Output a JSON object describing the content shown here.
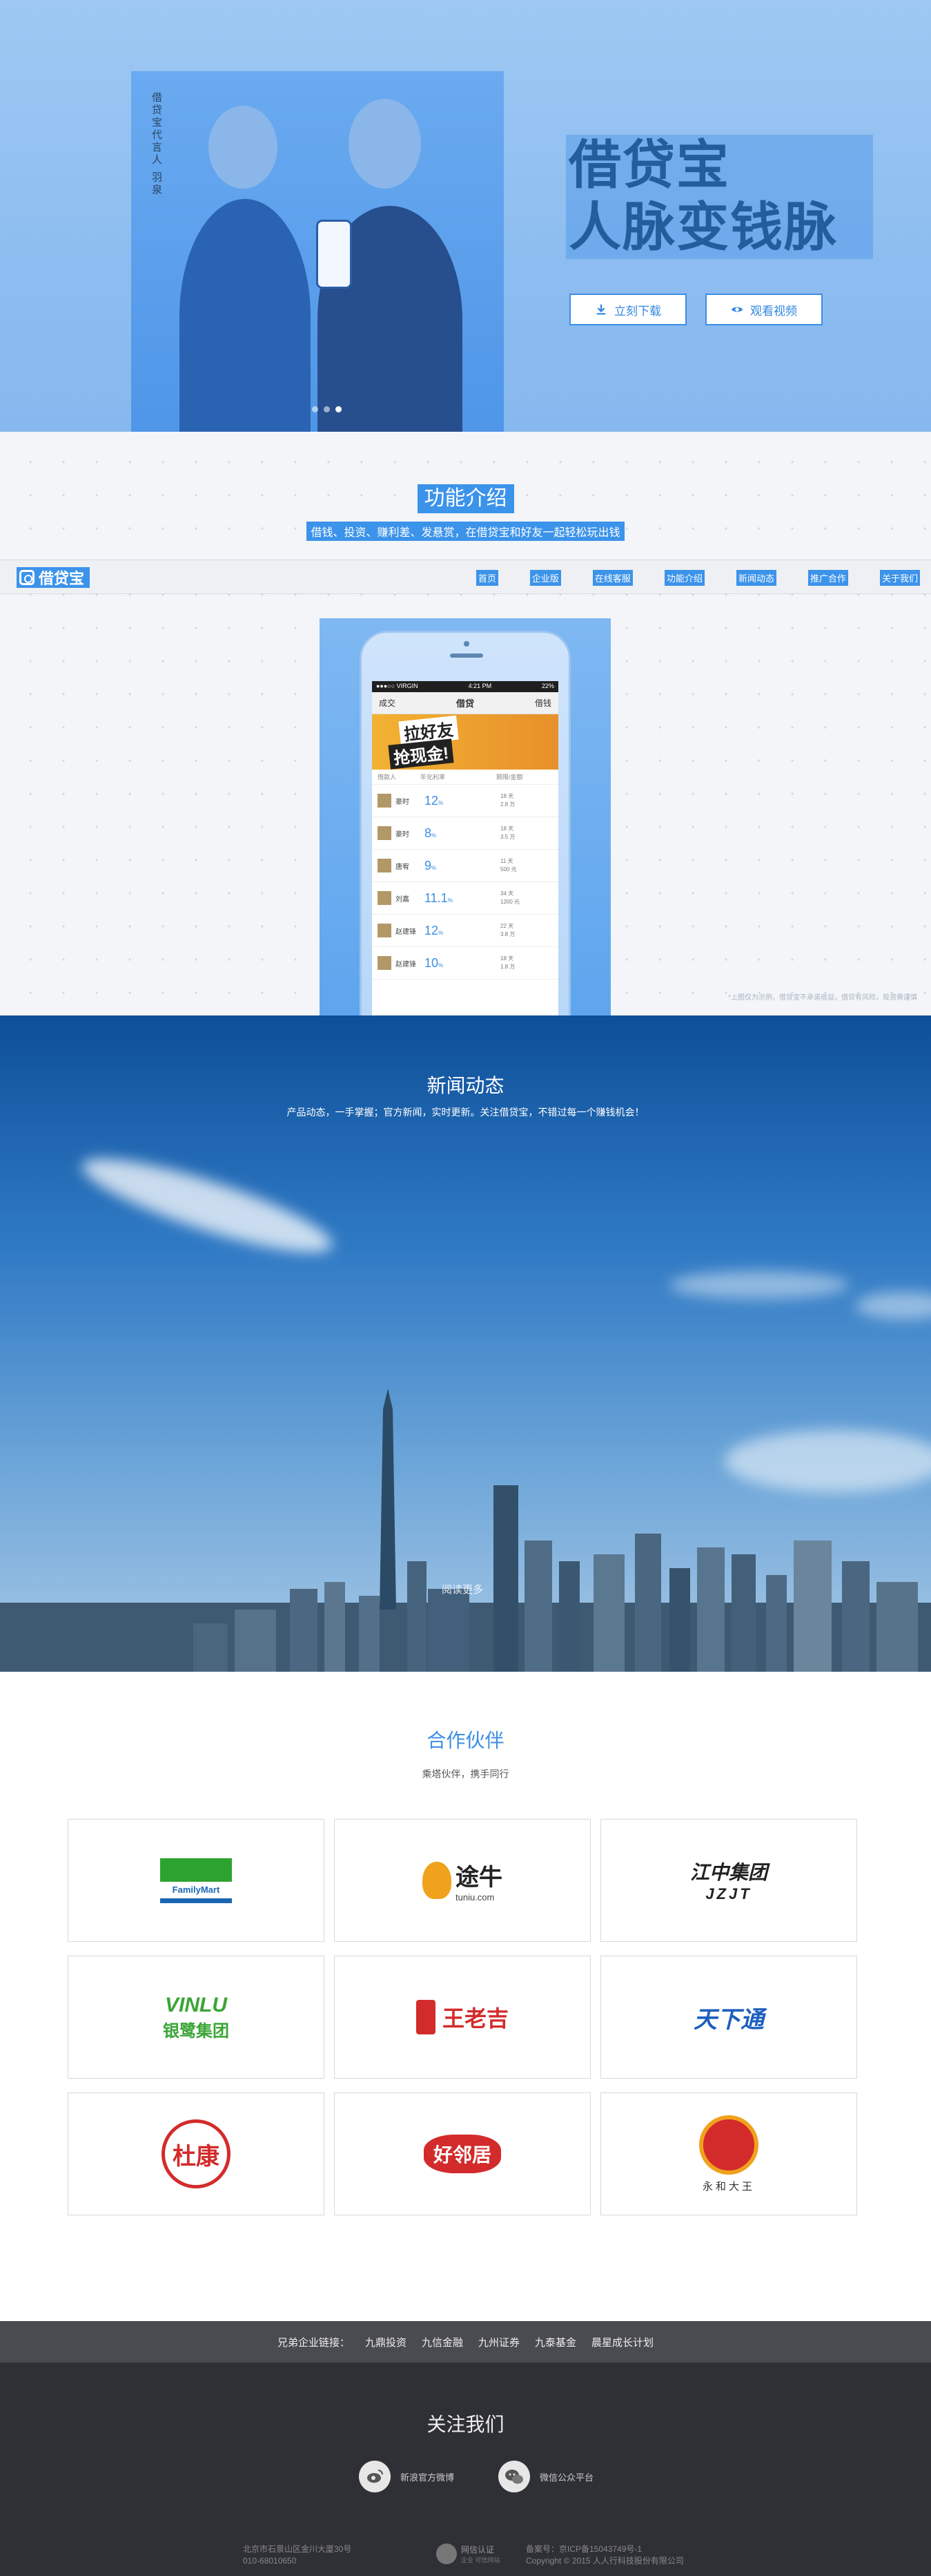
{
  "hero": {
    "caption": "借贷宝代言人 羽泉",
    "title_line1": "借贷宝",
    "title_line2": "人脉变钱脉",
    "download_label": "立刻下载",
    "video_label": "观看视频"
  },
  "features": {
    "title": "功能介绍",
    "subtitle": "借钱、投资、赚利差、发悬赏，在借贷宝和好友一起轻松玩出钱",
    "note": "*上图仅为示例，借贷宝不承诺收益，借贷有风险，投资需谨慎"
  },
  "nav": {
    "logo": "借贷宝",
    "items": [
      "首页",
      "企业版",
      "在线客服",
      "功能介绍",
      "新闻动态",
      "推广合作",
      "关于我们"
    ]
  },
  "app": {
    "status_left": "●●●○○ VIRGIN",
    "status_time": "4:21 PM",
    "status_right": "22%",
    "header_left": "成交",
    "header_title": "借贷",
    "header_right": "借钱",
    "banner_line1": "拉好友",
    "banner_line2": "抢现金!",
    "col_lender": "借款人",
    "col_rate": "年化利率",
    "col_term": "期限/金额",
    "rows": [
      {
        "name": "豪时",
        "rate": "12",
        "days": "18 天",
        "amount": "2.8 万"
      },
      {
        "name": "豪时",
        "rate": "8",
        "days": "18 天",
        "amount": "3.5 万"
      },
      {
        "name": "唐宥",
        "rate": "9",
        "days": "11 天",
        "amount": "500 元"
      },
      {
        "name": "刘嘉",
        "rate": "11.1",
        "days": "34 天",
        "amount": "1200 元"
      },
      {
        "name": "赵建锋",
        "rate": "12",
        "days": "22 天",
        "amount": "3.8 万"
      },
      {
        "name": "赵建锋",
        "rate": "10",
        "days": "18 天",
        "amount": "1.8 万"
      }
    ],
    "percent_sign": "%"
  },
  "news": {
    "title": "新闻动态",
    "subtitle": "产品动态，一手掌握；官方新闻，实时更新。关注借贷宝，不错过每一个赚钱机会！",
    "read_more": "阅读更多"
  },
  "partners": {
    "title": "合作伙伴",
    "subtitle": "乘塔伙伴，携手同行",
    "items": [
      {
        "name": "FamilyMart",
        "label": "FamilyMart"
      },
      {
        "name": "tuniu",
        "label": "途牛",
        "sub": "tuniu.com"
      },
      {
        "name": "jzjt",
        "label": "江中集团",
        "sub": "JZJT"
      },
      {
        "name": "yinlu",
        "label": "VINLU",
        "sub": "银鹭集团"
      },
      {
        "name": "wanglaoji",
        "label": "王老吉"
      },
      {
        "name": "tianxiatong",
        "label": "天下通"
      },
      {
        "name": "dukang",
        "label": "杜康"
      },
      {
        "name": "haoliju",
        "label": "好邻居"
      },
      {
        "name": "yonghe",
        "label": "永和大王"
      }
    ],
    "colors": {
      "familymart_green": "#2ca32e",
      "familymart_blue": "#1b66b3",
      "tuniu_orange": "#f0a21c",
      "red": "#d32b2b",
      "green": "#3aa535",
      "blue": "#1e5fbf"
    }
  },
  "friends": {
    "label": "兄弟企业链接：",
    "links": [
      "九鼎投资",
      "九信金融",
      "九州证券",
      "九泰基金",
      "晨星成长计划"
    ]
  },
  "footer": {
    "title": "关注我们",
    "weibo": "新浪官方微博",
    "wechat": "微信公众平台",
    "address": "北京市石景山区金川大厦30号",
    "phone": "010-68010650",
    "badge_title": "网信认证",
    "badge_sub": "企业 可信网站",
    "icp": "备案号：京ICP备15043749号-1",
    "copyright": "Copyright © 2015 人人行科技股份有限公司"
  },
  "accent": "#3c93ea"
}
